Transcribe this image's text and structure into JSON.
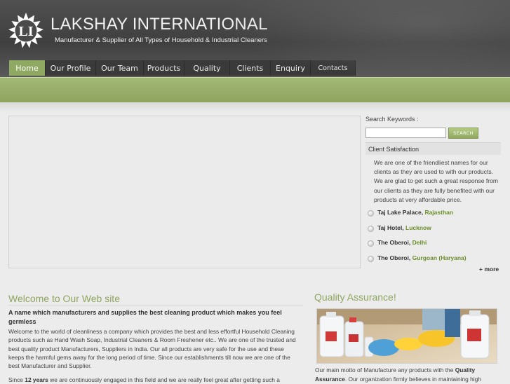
{
  "header": {
    "logo_text": "LI",
    "title": "LAKSHAY INTERNATIONAL",
    "tagline": "Manufacturer & Supplier of All Types of Household & Industrial Cleaners"
  },
  "nav": {
    "items": [
      {
        "label": "Home",
        "active": true
      },
      {
        "label": "Our Profile"
      },
      {
        "label": "Our Team"
      },
      {
        "label": "Products"
      },
      {
        "label": "Quality"
      },
      {
        "label": "Clients"
      },
      {
        "label": "Enquiry"
      },
      {
        "label": "Contacts"
      }
    ]
  },
  "search": {
    "label": "Search Keywords :",
    "value": "",
    "button": "SEARCH"
  },
  "sidebar": {
    "heading": "Client Satisfaction",
    "text": "We are one of the friendliest names for our clients as they are used to with our products. We are glad to get such a great response from our clients as they are fully benefited with our products at very affordable price.",
    "clients": [
      {
        "name": "Taj Lake Palace,",
        "city": "Rajasthan"
      },
      {
        "name": "Taj Hotel,",
        "city": "Lucknow"
      },
      {
        "name": "The Oberoi,",
        "city": "Delhi"
      },
      {
        "name": "The Oberoi,",
        "city": "Gurgoan (Haryana)"
      }
    ],
    "more": "+ more"
  },
  "welcome": {
    "title": "Welcome to Our Web site",
    "subtitle": "A name which manufacturers and supplies the best cleaning product which makes you feel germless",
    "body": "Welcome to the world of cleanliness a company which provides the best and less effortful Household Cleaning products such as Hand Wash Soap, Industrial Cleaners & Room Freshener etc.. We are one of the trusted and best quality product Manufacturers, Suppliers in India. Our all products are very safe for the use and these keeps the harmful gems away for the long period of time. Since our establishments till now we are one of the best Manufacturer and Supplier.",
    "body2_pre": "Since ",
    "body2_bold": "12 years",
    "body2_post": " we are continuously engaged in this field and we are really feel great after getting such a"
  },
  "quality": {
    "title": "Quality Assurance!",
    "body_pre": "Our main motto of Manufacture any products with the ",
    "body_bold1": "Quality Assurance",
    "body_post": ". Our organization firmly believes in maintaining high"
  },
  "colors": {
    "accent": "#8fa55f",
    "header_dark": "#454545",
    "city_link": "#6b8f2a"
  }
}
